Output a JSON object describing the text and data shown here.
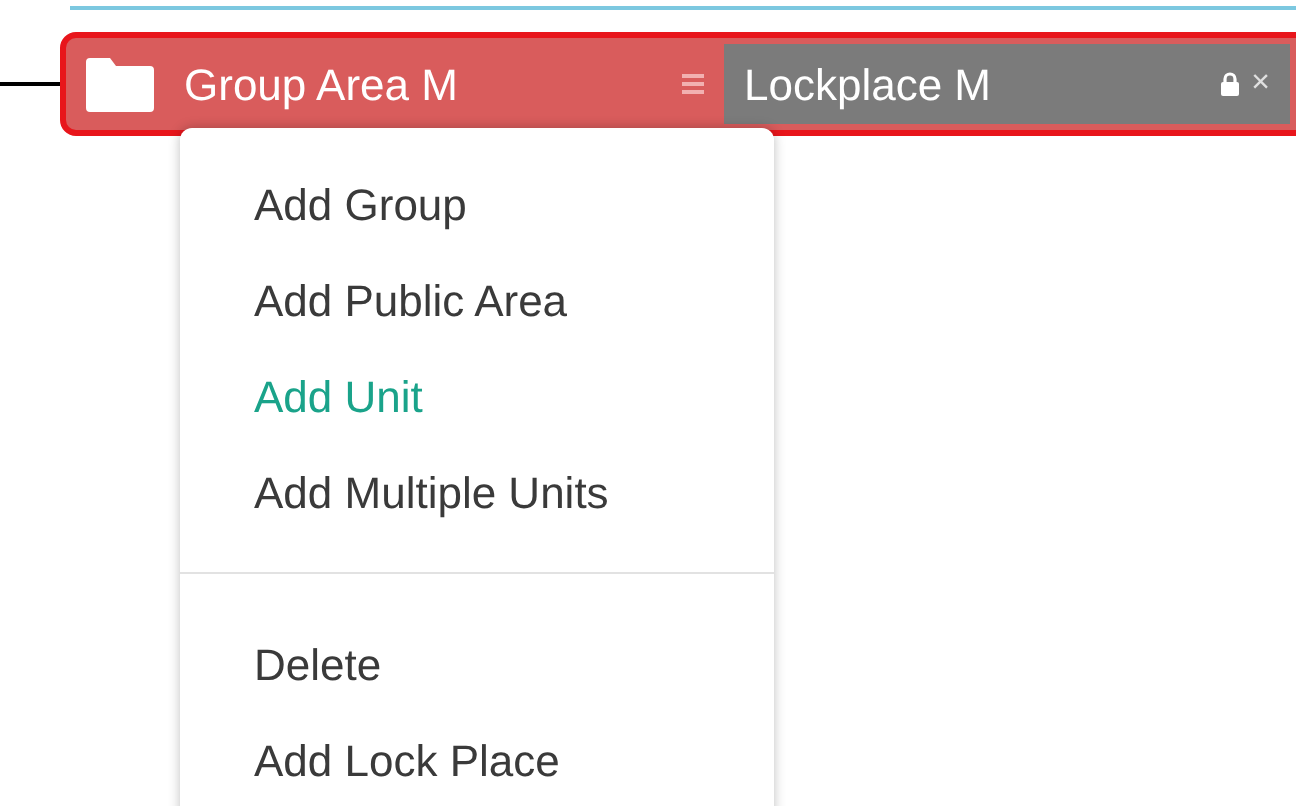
{
  "node": {
    "label": "Group Area M",
    "chip": {
      "label": "Lockplace M",
      "locked": true,
      "close": "×"
    }
  },
  "menu": {
    "groups": [
      {
        "items": [
          {
            "label": "Add Group",
            "selected": false
          },
          {
            "label": "Add Public Area",
            "selected": false
          },
          {
            "label": "Add Unit",
            "selected": true
          },
          {
            "label": "Add Multiple Units",
            "selected": false
          }
        ]
      },
      {
        "items": [
          {
            "label": "Delete",
            "selected": false
          },
          {
            "label": "Add Lock Place",
            "selected": false
          }
        ]
      }
    ]
  }
}
